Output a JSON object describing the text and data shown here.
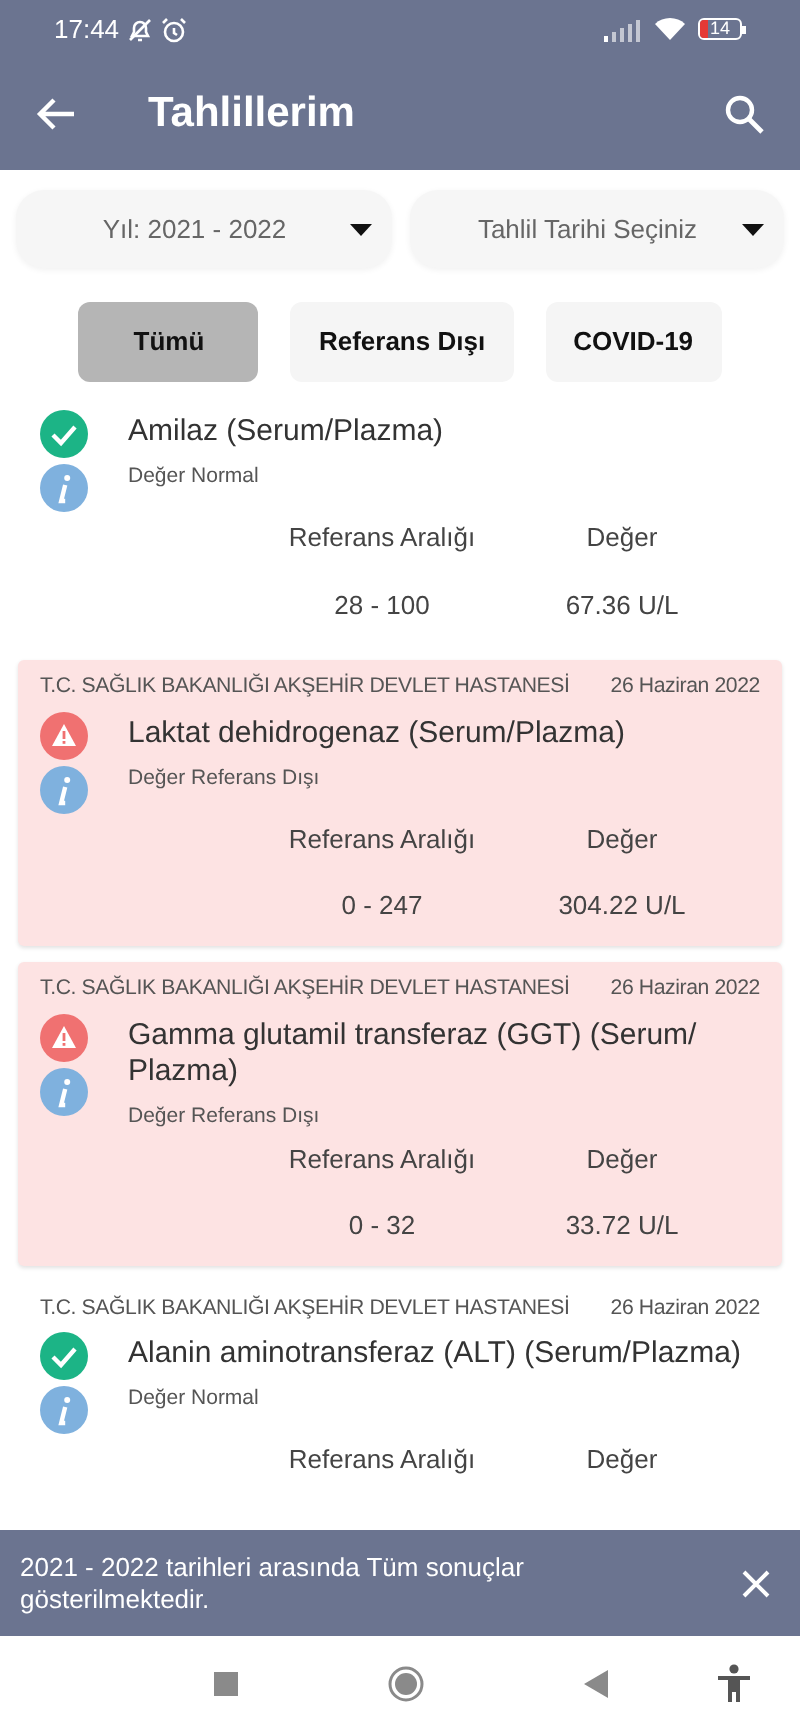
{
  "status_bar": {
    "time": "17:44",
    "battery": "14"
  },
  "app_bar": {
    "title": "Tahlillerim"
  },
  "filters": [
    {
      "label": "Yıl: 2021 - 2022"
    },
    {
      "label": "Tahlil Tarihi Seçiniz"
    }
  ],
  "chips": [
    {
      "label": "Tümü",
      "selected": true
    },
    {
      "label": "Referans Dışı",
      "selected": false
    },
    {
      "label": "COVID-19",
      "selected": false
    }
  ],
  "results": [
    {
      "kind": "normal",
      "name": "Amilaz (Serum/Plazma)",
      "status": "Değer Normal",
      "range_label": "Referans Aralığı",
      "value_label": "Değer",
      "range": "28 - 100",
      "value": "67.36 U/L"
    },
    {
      "kind": "abnormal",
      "hospital": "T.C. SAĞLIK BAKANLIĞI AKŞEHİR DEVLET HASTANESİ",
      "date": "26 Haziran 2022",
      "name": "Laktat dehidrogenaz (Serum/Plazma)",
      "status": "Değer Referans Dışı",
      "range_label": "Referans Aralığı",
      "value_label": "Değer",
      "range": "0 - 247",
      "value": "304.22 U/L"
    },
    {
      "kind": "abnormal",
      "hospital": "T.C. SAĞLIK BAKANLIĞI AKŞEHİR DEVLET HASTANESİ",
      "date": "26 Haziran 2022",
      "name": "Gamma glutamil transferaz (GGT) (Serum/ Plazma)",
      "status": "Değer Referans Dışı",
      "range_label": "Referans Aralığı",
      "value_label": "Değer",
      "range": "0 - 32",
      "value": "33.72 U/L"
    },
    {
      "kind": "normal",
      "hospital": "T.C. SAĞLIK BAKANLIĞI AKŞEHİR DEVLET HASTANESİ",
      "date": "26 Haziran 2022",
      "name": "Alanin aminotransferaz (ALT) (Serum/Plazma)",
      "status": "Değer Normal",
      "range_label": "Referans Aralığı",
      "value_label": "Değer"
    }
  ],
  "snackbar": {
    "message": "2021 - 2022 tarihleri arasında Tüm sonuçlar gösterilmektedir."
  }
}
